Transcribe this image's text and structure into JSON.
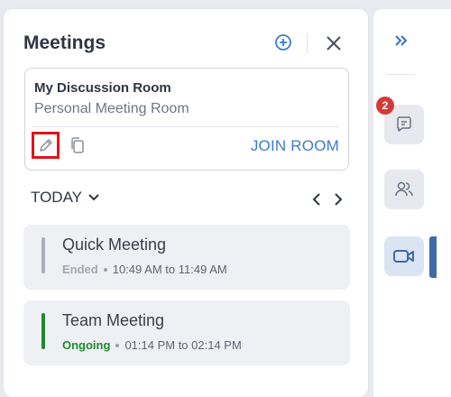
{
  "panel": {
    "title": "Meetings",
    "header_icons": [
      "add-circle-icon",
      "close-icon"
    ]
  },
  "room_card": {
    "name": "My Discussion Room",
    "subtitle": "Personal Meeting Room",
    "join_label": "JOIN ROOM",
    "icons": [
      "pencil-icon",
      "copy-icon"
    ]
  },
  "date_filter": {
    "label": "TODAY"
  },
  "meetings": [
    {
      "title": "Quick Meeting",
      "status": "Ended",
      "time": "10:49 AM to 11:49 AM",
      "accent": "#a9adb5"
    },
    {
      "title": "Team Meeting",
      "status": "Ongoing",
      "time": "01:14 PM to 02:14 PM",
      "accent": "#1f8a2d"
    }
  ],
  "rail": {
    "chat_badge_count": "2",
    "icons": [
      "double-chevron-right-icon",
      "chat-icon",
      "participants-icon",
      "video-camera-icon"
    ]
  },
  "colors": {
    "accent_blue": "#3a7bd5",
    "highlight_red": "#e1141b",
    "ongoing_green": "#1f8a2d",
    "badge_red": "#d43a3a"
  }
}
